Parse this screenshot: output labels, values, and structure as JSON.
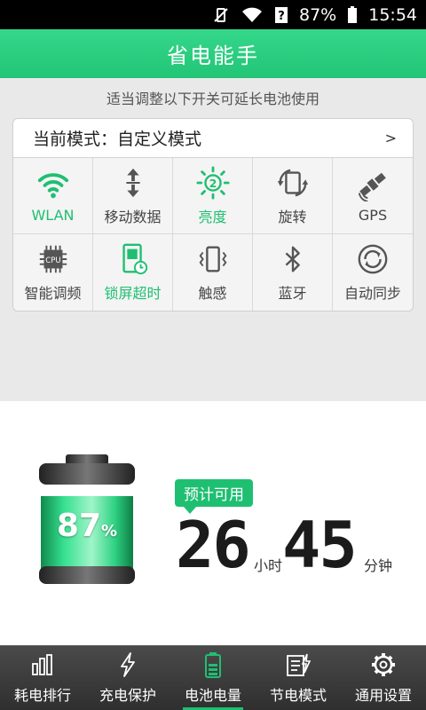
{
  "status_bar": {
    "battery_percent": "87%",
    "time": "15:54"
  },
  "header": {
    "title": "省电能手"
  },
  "hint_text": "适当调整以下开关可延长电池使用",
  "mode": {
    "label": "当前模式：自定义模式",
    "arrow": ">"
  },
  "toggles": [
    {
      "label": "WLAN",
      "icon": "wifi-icon",
      "on": true
    },
    {
      "label": "移动数据",
      "icon": "mobile-data-icon",
      "on": false
    },
    {
      "label": "亮度",
      "icon": "brightness-icon",
      "on": true
    },
    {
      "label": "旋转",
      "icon": "rotate-icon",
      "on": false
    },
    {
      "label": "GPS",
      "icon": "gps-satellite-icon",
      "on": false
    },
    {
      "label": "智能调频",
      "icon": "cpu-icon",
      "on": false
    },
    {
      "label": "锁屏超时",
      "icon": "screen-timeout-icon",
      "on": true
    },
    {
      "label": "触感",
      "icon": "vibrate-icon",
      "on": false
    },
    {
      "label": "蓝牙",
      "icon": "bluetooth-icon",
      "on": false
    },
    {
      "label": "自动同步",
      "icon": "sync-icon",
      "on": false
    }
  ],
  "brightness_level": "2",
  "cpu_text": "CPU",
  "battery": {
    "percent": "87",
    "unit": "%",
    "level": 0.87
  },
  "estimate": {
    "badge": "预计可用",
    "hours": "26",
    "hours_unit": "小时",
    "minutes": "45",
    "minutes_unit": "分钟"
  },
  "tabs": [
    {
      "label": "耗电排行",
      "icon": "bar-chart-icon",
      "active": false
    },
    {
      "label": "充电保护",
      "icon": "lightning-icon",
      "active": false
    },
    {
      "label": "电池电量",
      "icon": "battery-icon",
      "active": true
    },
    {
      "label": "节电模式",
      "icon": "power-save-icon",
      "active": false
    },
    {
      "label": "通用设置",
      "icon": "gear-icon",
      "active": false
    }
  ],
  "colors": {
    "accent": "#1fbf72",
    "header": "#22c476"
  }
}
